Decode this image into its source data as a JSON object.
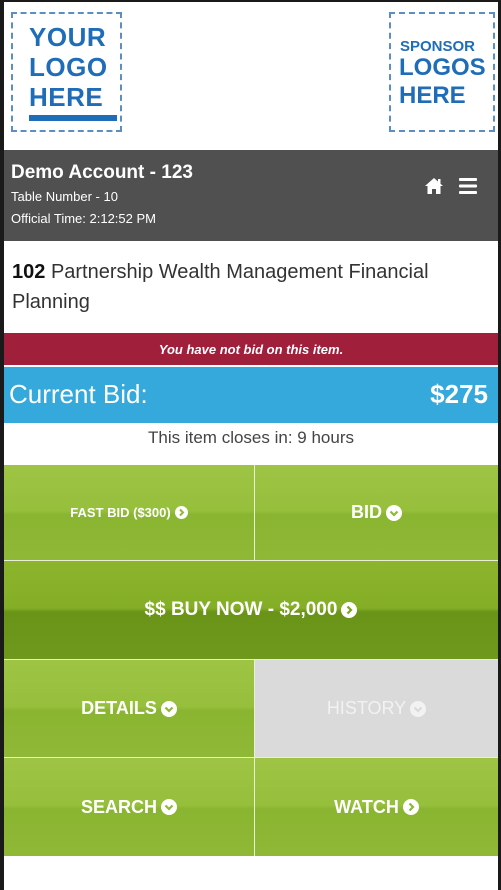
{
  "logos": {
    "left_text": "YOUR LOGO HERE",
    "right_line1": "SPONSOR",
    "right_line2": "LOGOS HERE"
  },
  "header": {
    "account": "Demo Account - 123",
    "table_number": "Table Number - 10",
    "official_time": "Official Time: 2:12:52 PM",
    "icons": [
      "home-icon",
      "menu-icon"
    ]
  },
  "item": {
    "number": "102",
    "name": "Partnership Wealth Management Financial Planning"
  },
  "status_message": "You have not bid on this item.",
  "current_bid": {
    "label": "Current Bid:",
    "value": "$275"
  },
  "closes_text": "This item closes in: 9 hours",
  "buttons": {
    "fast_bid": "FAST BID ($300)",
    "bid": "BID",
    "buy_now": "$$ BUY NOW - $2,000",
    "details": "DETAILS",
    "history": "HISTORY",
    "search": "SEARCH",
    "watch": "WATCH"
  },
  "colors": {
    "header_bg": "#505050",
    "status_bg": "#a0203c",
    "bid_bar_bg": "#35a8dc",
    "button_green": "#96bf3c",
    "buy_now_green": "#7aa320",
    "disabled_gray": "#dadada"
  }
}
